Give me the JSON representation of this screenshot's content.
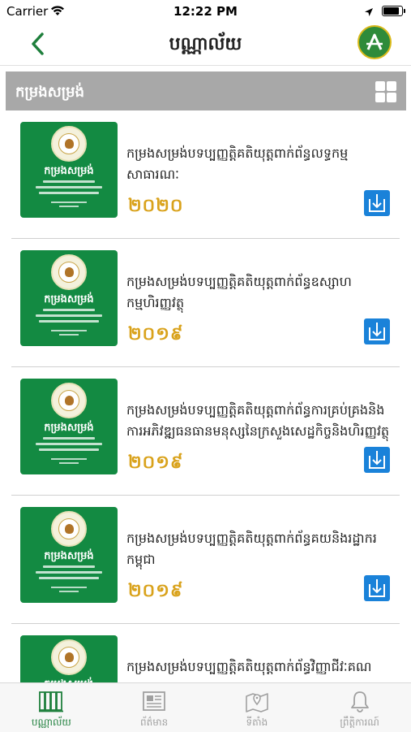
{
  "status_bar": {
    "carrier": "Carrier",
    "time": "12:22 PM"
  },
  "nav": {
    "title": "បណ្ណាល័យ",
    "back_icon": "chevron-left-icon",
    "brand_icon": "app-logo-icon"
  },
  "section": {
    "label": "កម្រងសម្រង់",
    "view_icon": "grid-view-icon"
  },
  "books": [
    {
      "title": "កម្រងសម្រង់បទប្បញ្ញត្តិគតិយុត្តពាក់ព័ន្ធលទ្ធកម្មសាធារណៈ",
      "year": "២០២០"
    },
    {
      "title": "កម្រងសម្រង់បទប្បញ្ញត្តិគតិយុត្តពាក់ព័ន្ធឧស្សាហកម្មហិរញ្ញវត្ថុ",
      "year": "២០១៩"
    },
    {
      "title": "កម្រងសម្រង់បទប្បញ្ញត្តិគតិយុត្តពាក់ព័ន្ធការគ្រប់គ្រងនិងការអភិវឌ្ឍធនធានមនុស្សនៃក្រសួងសេដ្ឋកិច្ចនិងហិរញ្ញវត្ថុ",
      "year": "២០១៩"
    },
    {
      "title": "កម្រងសម្រង់បទប្បញ្ញត្តិគតិយុត្តពាក់ព័ន្ធគយនិងរដ្ឋាករកម្ពុជា",
      "year": "២០១៩"
    },
    {
      "title": "កម្រងសម្រង់បទប្បញ្ញត្តិគតិយុត្តពាក់ព័ន្ធវិញ្ញាជីវៈគណ",
      "year": ""
    }
  ],
  "cover": {
    "label": "កម្រងសម្រង់"
  },
  "tabs": [
    {
      "label": "បណ្ណាល័យ",
      "icon": "library-icon",
      "active": true
    },
    {
      "label": "ព័ត៌មាន",
      "icon": "news-icon",
      "active": false
    },
    {
      "label": "ទីតាំង",
      "icon": "map-pin-icon",
      "active": false
    },
    {
      "label": "ព្រឹត្តិការណ៍",
      "icon": "bell-icon",
      "active": false
    }
  ],
  "colors": {
    "brand_green": "#138a42",
    "year_gold": "#d9a21b",
    "download_blue": "#1a82d9",
    "header_gray": "#a8a8a8"
  }
}
